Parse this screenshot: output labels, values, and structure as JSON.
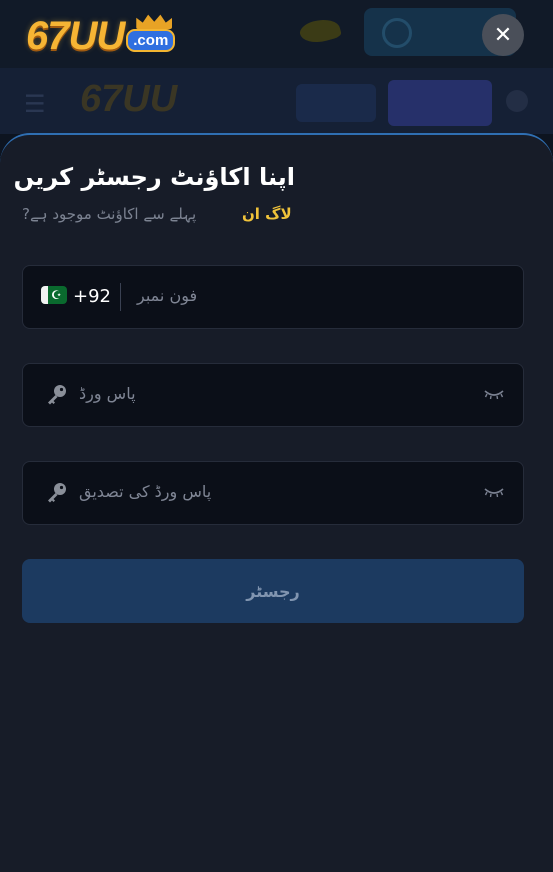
{
  "background": {
    "header_text": "",
    "logo_text": "67UU"
  },
  "logo": {
    "main": "67UU",
    "suffix": ".com"
  },
  "close_label": "✕",
  "form": {
    "title": "اپنا اکاؤنٹ رجسٹر کریں",
    "subtitle_prefix": "?پہلے سے اکاؤنٹ موجود ہے",
    "login_link": "لاگ ان",
    "phone": {
      "country_code": "+92",
      "flag_mark": "☪",
      "placeholder": "فون نمبر"
    },
    "password": {
      "placeholder": "پاس ورڈ"
    },
    "confirm_password": {
      "placeholder": "پاس ورڈ کی تصدیق"
    },
    "submit_label": "رجسٹر"
  },
  "icons": {
    "close": "close-icon",
    "key": "key-icon",
    "eye": "eye-closed-icon",
    "flag": "pakistan-flag-icon"
  },
  "colors": {
    "accent": "#f0c33a",
    "sheet_border": "#2f6fb3",
    "submit_bg": "#1c3a60",
    "logo_gold": "#f6b534",
    "logo_blue": "#2f6fe0"
  }
}
